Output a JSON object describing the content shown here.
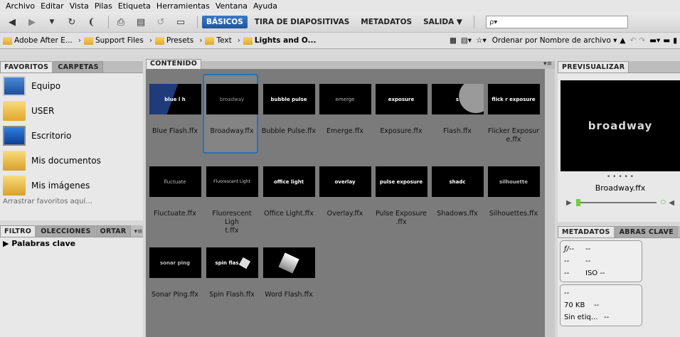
{
  "menubar": [
    "Archivo",
    "Editar",
    "Vista",
    "Pilas",
    "Etiqueta",
    "Herramientas",
    "Ventana",
    "Ayuda"
  ],
  "toolbar": {
    "workspaces": [
      "BÁSICOS",
      "TIRA DE DIAPOSITIVAS",
      "METADATOS",
      "SALIDA ▼"
    ],
    "search_placeholder": "ρ▾"
  },
  "path": {
    "crumbs": [
      "Adobe After E...",
      "Support Files",
      "Presets",
      "Text",
      "Lights and O..."
    ],
    "sort_label": "Ordenar por Nombre de archivo ▾"
  },
  "left_panel": {
    "tabs": [
      "FAVORITOS",
      "CARPETAS"
    ],
    "favorites": [
      {
        "label": "Equipo",
        "icon": "computer-icon"
      },
      {
        "label": "USER",
        "icon": "folder-icon"
      },
      {
        "label": "Escritorio",
        "icon": "desktop-icon"
      },
      {
        "label": "Mis documentos",
        "icon": "documents-icon"
      },
      {
        "label": "Mis imágenes",
        "icon": "pictures-icon"
      }
    ],
    "hint": "Arrastrar favoritos aquí..."
  },
  "filter_panel": {
    "tabs": [
      "FILTRO",
      "OLECCIONES",
      "ORTAR"
    ],
    "item": "Palabras clave"
  },
  "content": {
    "tab": "CONTENIDO",
    "items": [
      {
        "thumb": "blue  l  h",
        "label": "Blue Flash.ffx"
      },
      {
        "thumb": "broadway",
        "label": "Broadway.ffx"
      },
      {
        "thumb": "bubble pulse",
        "label": "Bubble Pulse.ffx"
      },
      {
        "thumb": "emerge",
        "label": "Emerge.ffx"
      },
      {
        "thumb": "exposure",
        "label": "Exposure.ffx"
      },
      {
        "thumb": "s",
        "label": "Flash.ffx"
      },
      {
        "thumb": "flick r exposure",
        "label": "Flicker Exposure.ffx"
      },
      {
        "thumb": "fluctuate",
        "label": "Fluctuate.ffx"
      },
      {
        "thumb": "Fluorescent Light",
        "label": "Fluorescent Light.ffx"
      },
      {
        "thumb": "office light",
        "label": "Office Light.ffx"
      },
      {
        "thumb": "overlay",
        "label": "Overlay.ffx"
      },
      {
        "thumb": "pulse exposure",
        "label": "Pulse Exposure.ffx"
      },
      {
        "thumb": "shadc",
        "label": "Shadows.ffx"
      },
      {
        "thumb": "silhouette",
        "label": "Silhouettes.ffx"
      },
      {
        "thumb": "sonar ping",
        "label": "Sonar Ping.ffx"
      },
      {
        "thumb": "spin flas",
        "label": "Spin Flash.ffx"
      },
      {
        "thumb": "",
        "label": "Word Flash.ffx"
      }
    ],
    "label_lines": {
      "flicker": [
        "Flicker Exposur",
        "e.ffx"
      ],
      "fluorescent": [
        "Fluorescent Ligh",
        "t.ffx"
      ],
      "pulse": [
        "Pulse Exposure",
        ".ffx"
      ]
    }
  },
  "preview_panel": {
    "tab": "PREVISUALIZAR",
    "preview_text": "broadway",
    "dots": "• • • • •",
    "filename": "Broadway.ffx"
  },
  "metadata_panel": {
    "tabs": [
      "METADATOS",
      "ABRAS CLAVE"
    ],
    "rows1": [
      [
        "ƒ/--",
        "--"
      ],
      [
        "--",
        "--"
      ],
      [
        "--",
        "ISO --"
      ]
    ],
    "rows2": [
      [
        "--",
        ""
      ],
      [
        "70 KB",
        "--"
      ],
      [
        "Sin etiq...",
        "--"
      ]
    ]
  }
}
